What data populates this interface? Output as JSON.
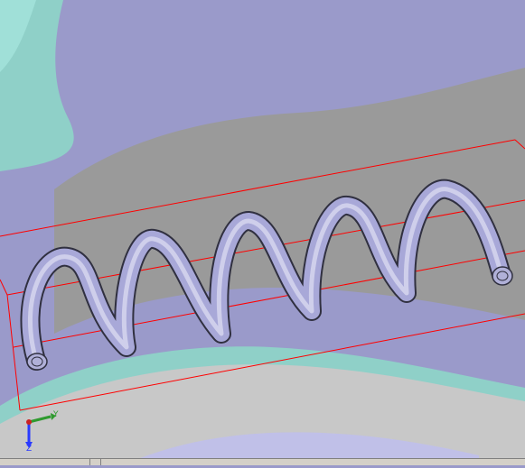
{
  "viewport": {
    "background_colors": [
      "#9a9aca",
      "#9a9a9a",
      "#8fd0c8",
      "#c8c8c8"
    ],
    "bounding_box_color": "#ff0000"
  },
  "model": {
    "shape": "helical-spring",
    "coil_count": 5,
    "tube_color": "#a8a8d8"
  },
  "triad": {
    "y_label": "Y",
    "z_label": "Z",
    "y_color": "#2e9a2e",
    "z_color": "#2a3aff"
  },
  "statusbar": {
    "text": ""
  }
}
